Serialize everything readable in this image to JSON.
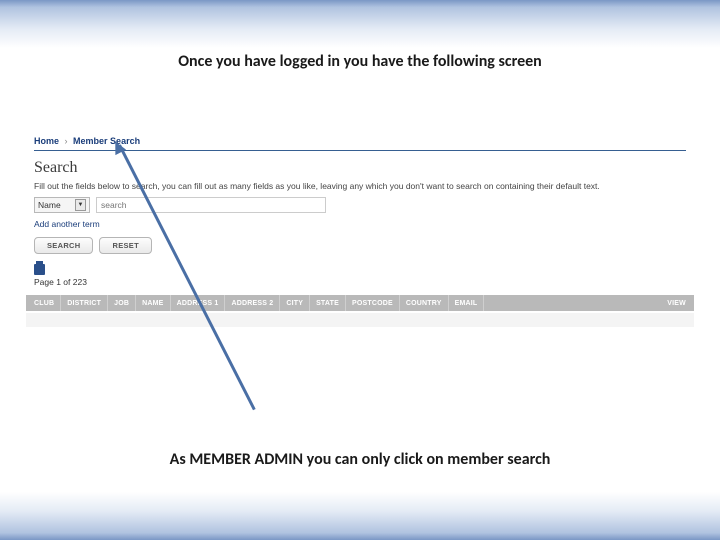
{
  "captions": {
    "top": "Once you have logged in you have the following screen",
    "bottom": "As MEMBER ADMIN you can only click on member search"
  },
  "screenshot": {
    "breadcrumb": [
      "Home",
      "Member Search"
    ],
    "heading": "Search",
    "instructions": "Fill out the fields below to search, you can fill out as many fields as you like, leaving any which you don't want to search on containing their default text.",
    "filter": {
      "field_selected": "Name",
      "search_placeholder": "search"
    },
    "add_term": "Add another term",
    "buttons": {
      "search": "SEARCH",
      "reset": "RESET"
    },
    "pagination": "Page 1 of 223",
    "columns": [
      "CLUB",
      "DISTRICT",
      "JOB",
      "NAME",
      "ADDRESS 1",
      "ADDRESS 2",
      "CITY",
      "STATE",
      "POSTCODE",
      "COUNTRY",
      "EMAIL",
      "VIEW"
    ]
  }
}
